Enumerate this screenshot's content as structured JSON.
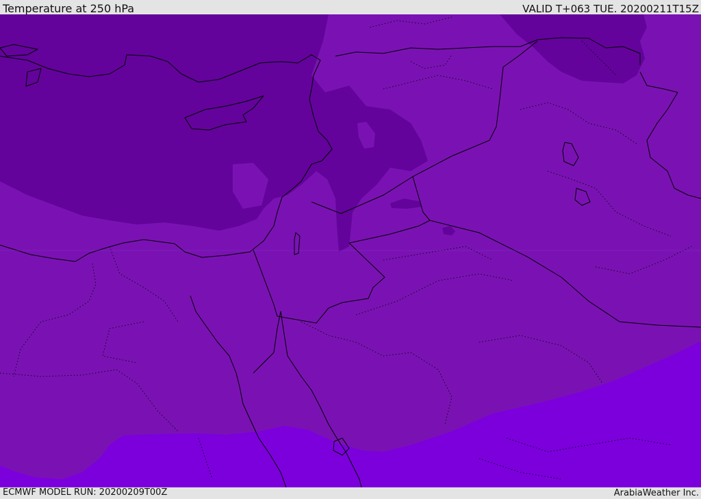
{
  "header": {
    "title": "Temperature at 250 hPa",
    "valid_time": "VALID T+063 TUE. 20200211T15Z"
  },
  "footer": {
    "model_run": "ECMWF MODEL RUN: 20200209T00Z",
    "credit": "ArabiaWeather Inc."
  },
  "colors": {
    "background_bar": "#e4e4e4",
    "coldest_band": "#63039b",
    "middle_band": "#7a12b3",
    "warmest_band": "#7c00dc",
    "borders": "#000000"
  }
}
